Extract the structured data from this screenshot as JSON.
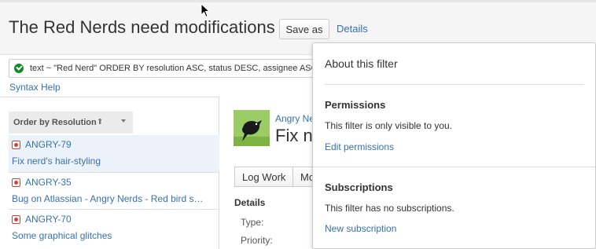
{
  "header": {
    "title": "The Red Nerds need modifications",
    "save_as": "Save as",
    "details": "Details"
  },
  "search": {
    "query": "text ~ \"Red Nerd\" ORDER BY resolution ASC, status DESC, assignee ASC",
    "syntax_help": "Syntax Help",
    "valid_icon": "check-circle-icon"
  },
  "results": {
    "order_label": "Order by Resolution",
    "order_arrow": "⬆",
    "issues": [
      {
        "key": "ANGRY-79",
        "summary": "Fix nerd's hair-styling",
        "selected": true
      },
      {
        "key": "ANGRY-35",
        "summary": "Bug on Atlassian - Angry Nerds - Red bird s…",
        "selected": false
      },
      {
        "key": "ANGRY-70",
        "summary": "Some graphical glitches",
        "selected": false
      }
    ]
  },
  "issue_view": {
    "reporter": "Angry Ne",
    "title": "Fix ne",
    "toolbar": [
      "Log Work",
      "Mo"
    ],
    "details_heading": "Details",
    "fields": [
      "Type:",
      "Priority:"
    ]
  },
  "filter_details": {
    "about": "About this filter",
    "permissions_heading": "Permissions",
    "permissions_text": "This filter is only visible to you.",
    "edit_permissions": "Edit permissions",
    "subscriptions_heading": "Subscriptions",
    "subscriptions_text": "This filter has no subscriptions.",
    "new_subscription": "New subscription"
  },
  "colors": {
    "link": "#3572b0",
    "selected_row": "#ebf2f9",
    "bug": "#d04437",
    "valid": "#14892c"
  }
}
